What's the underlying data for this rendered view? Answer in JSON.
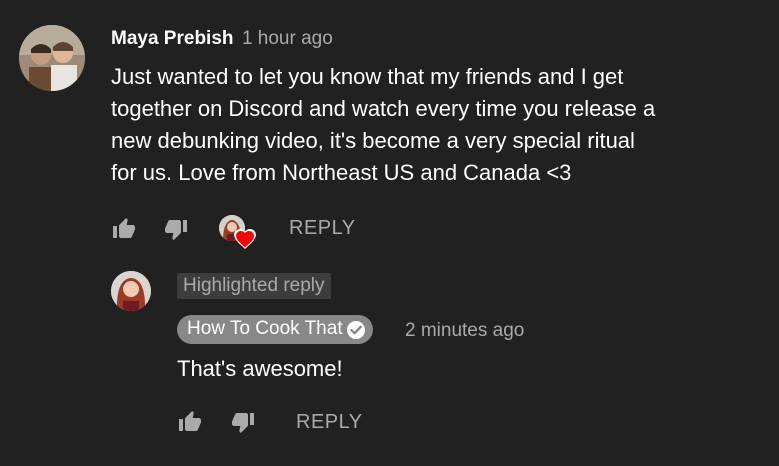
{
  "comment": {
    "author": "Maya Prebish",
    "time": "1 hour ago",
    "text_lines": [
      "Just wanted to let you know that my friends and I get",
      "together on Discord and watch every time you release a",
      "new debunking video, it's become a very special ritual",
      "for us. Love from Northeast US and Canada <3"
    ],
    "reply_label": "REPLY"
  },
  "reply": {
    "badge": "Highlighted reply",
    "author": "How To Cook That",
    "time": "2 minutes ago",
    "text": "That's awesome!",
    "reply_label": "REPLY"
  },
  "colors": {
    "background": "#212121",
    "heart": "#ff0000",
    "muted": "#aaaaaa"
  }
}
